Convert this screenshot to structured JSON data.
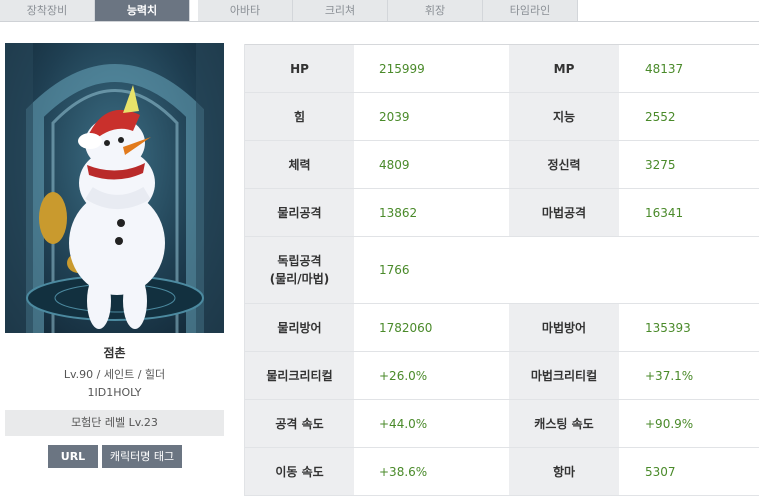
{
  "tabs": [
    {
      "label": "장착장비",
      "active": false
    },
    {
      "label": "능력치",
      "active": true
    },
    {
      "label": "아바타",
      "active": false
    },
    {
      "label": "크리쳐",
      "active": false
    },
    {
      "label": "휘장",
      "active": false
    },
    {
      "label": "타임라인",
      "active": false
    }
  ],
  "character": {
    "name": "점촌",
    "level_class": "Lv.90 / 세인트 / 힐더",
    "guild": "1ID1HOLY",
    "adventure_label": "모험단 레벨 Lv.23",
    "url_button": "URL",
    "tag_button": "캐릭터명 태그"
  },
  "stats": {
    "rows": [
      {
        "l1": "HP",
        "v1": "215999",
        "l2": "MP",
        "v2": "48137"
      },
      {
        "l1": "힘",
        "v1": "2039",
        "l2": "지능",
        "v2": "2552"
      },
      {
        "l1": "체력",
        "v1": "4809",
        "l2": "정신력",
        "v2": "3275"
      },
      {
        "l1": "물리공격",
        "v1": "13862",
        "l2": "마법공격",
        "v2": "16341"
      },
      {
        "l1": "독립공격\n(물리/마법)",
        "v1": "1766",
        "l2": "",
        "v2": ""
      },
      {
        "l1": "물리방어",
        "v1": "1782060",
        "l2": "마법방어",
        "v2": "135393"
      },
      {
        "l1": "물리크리티컬",
        "v1": "+26.0%",
        "l2": "마법크리티컬",
        "v2": "+37.1%"
      },
      {
        "l1": "공격 속도",
        "v1": "+44.0%",
        "l2": "캐스팅 속도",
        "v2": "+90.9%"
      },
      {
        "l1": "이동 속도",
        "v1": "+38.6%",
        "l2": "항마",
        "v2": "5307"
      }
    ]
  },
  "colors": {
    "tab_active": "#6b7582",
    "value_green": "#4a8a2a",
    "label_bg": "#edeef0"
  }
}
